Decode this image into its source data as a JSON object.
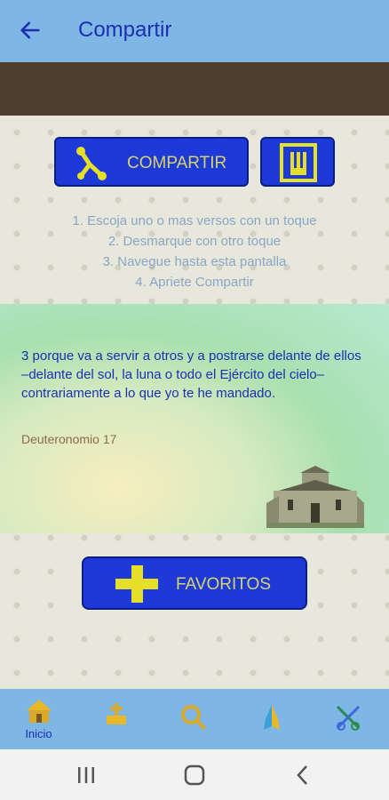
{
  "appbar": {
    "title": "Compartir",
    "back_icon": "arrow-left-icon"
  },
  "actions": {
    "share_label": "COMPARTIR",
    "share_icon": "share-nodes-icon",
    "font_icon": "font-size-icon"
  },
  "instructions": [
    "1. Escoja uno o mas versos con un toque",
    "2. Desmarque con otro toque",
    "3. Navegue hasta esta pantalla",
    "4. Apriete Compartir"
  ],
  "verse": {
    "text": "3 porque va a servir a otros y a postrarse delante de ellos –delante del sol, la luna o todo el Ejército del cielo– contrariamente a lo que yo te he mandado.",
    "reference": "Deuteronomio 17"
  },
  "favorites": {
    "label": "FAVORITOS",
    "icon": "plus-icon"
  },
  "bottom_nav": [
    {
      "label": "Inicio",
      "icon": "home-icon"
    },
    {
      "label": "",
      "icon": "bible-icon"
    },
    {
      "label": "",
      "icon": "search-icon"
    },
    {
      "label": "",
      "icon": "praying-hands-icon"
    },
    {
      "label": "",
      "icon": "tools-icon"
    }
  ],
  "colors": {
    "accent": "#1d3ad8",
    "appbar": "#7eb6e6",
    "brown": "#4e3e2e",
    "button_text": "#d6d36a"
  }
}
